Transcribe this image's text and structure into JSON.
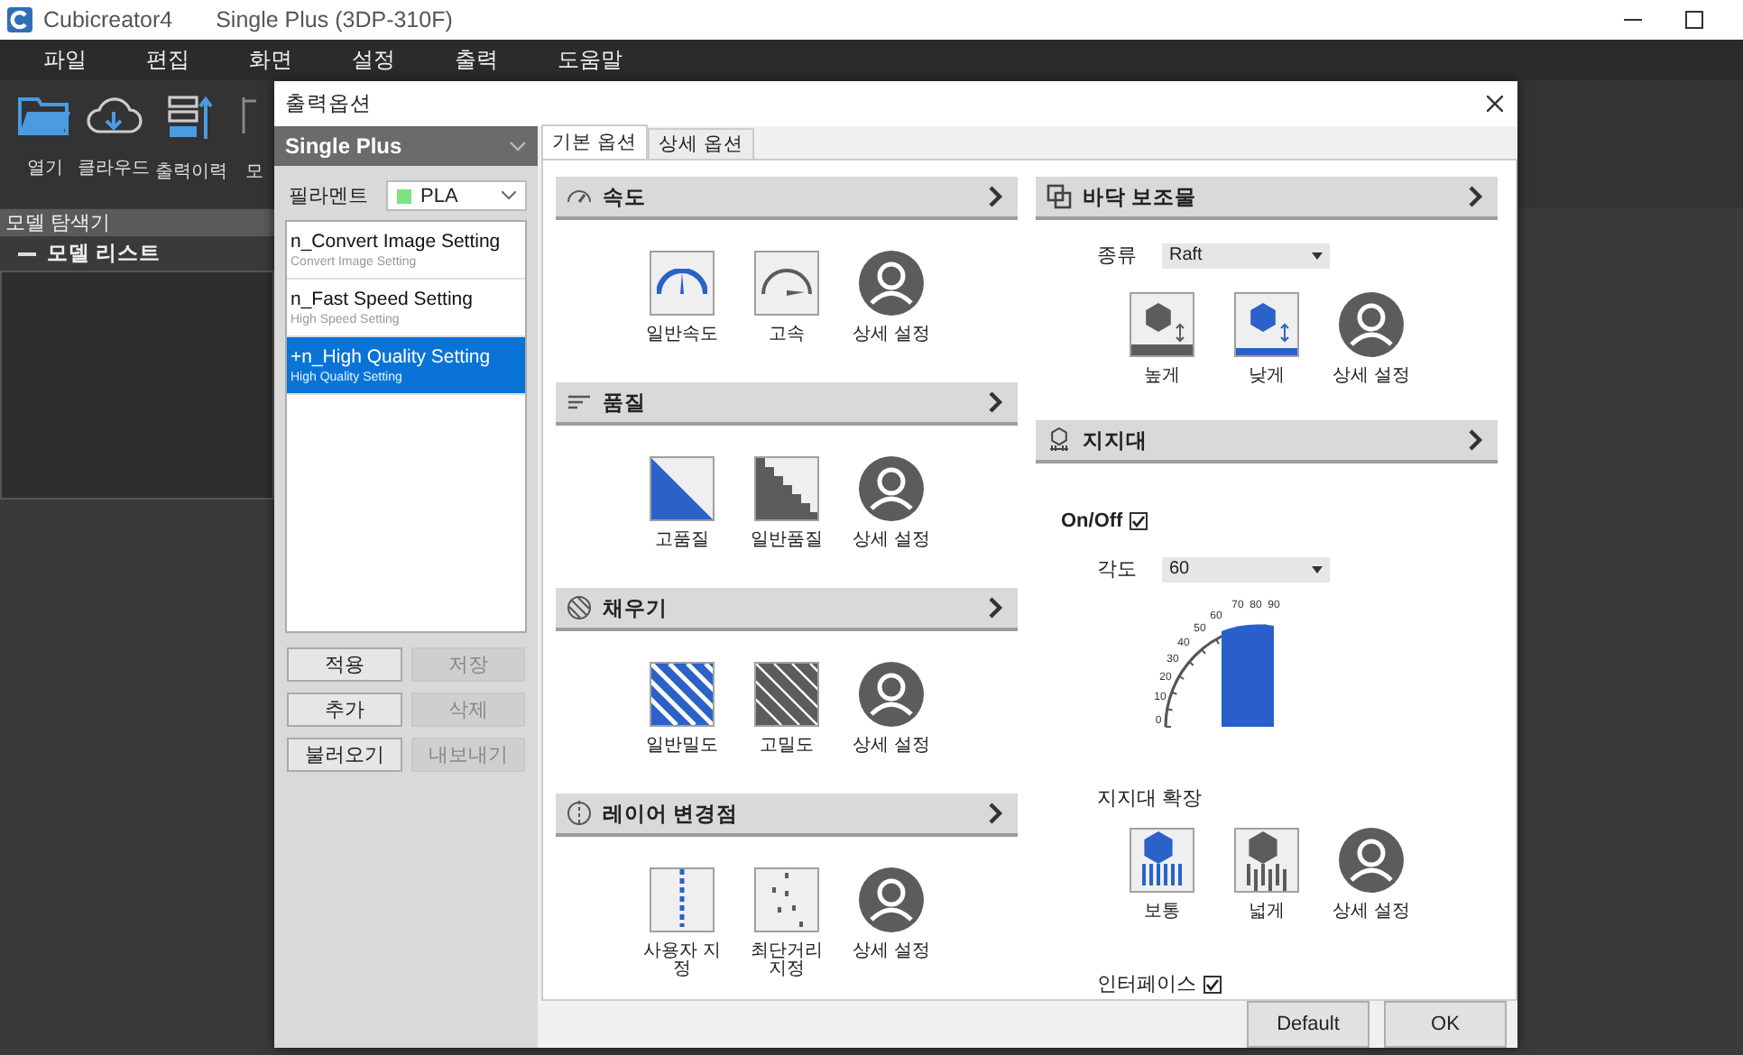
{
  "app": {
    "name": "Cubicreator4",
    "document": "Single Plus (3DP-310F)"
  },
  "menu": [
    "파일",
    "편집",
    "화면",
    "설정",
    "출력",
    "도움말"
  ],
  "toolbar": [
    {
      "label": "열기"
    },
    {
      "label": "클라우드"
    },
    {
      "label": "출력이력"
    },
    {
      "label": "모"
    }
  ],
  "explorer": {
    "title": "모델 탐색기",
    "list_title": "모델 리스트"
  },
  "dialog": {
    "title": "출력옵션",
    "printer": "Single Plus",
    "filament": {
      "label": "필라멘트",
      "value": "PLA"
    },
    "profiles": [
      {
        "name": "n_Convert Image Setting",
        "sub": "Convert Image Setting",
        "selected": false
      },
      {
        "name": "n_Fast Speed Setting",
        "sub": "High Speed Setting",
        "selected": false
      },
      {
        "name": "+n_High Quality Setting",
        "sub": "High Quality Setting",
        "selected": true
      }
    ],
    "buttons": [
      {
        "label": "적용",
        "disabled": false
      },
      {
        "label": "저장",
        "disabled": true
      },
      {
        "label": "추가",
        "disabled": false
      },
      {
        "label": "삭제",
        "disabled": true
      },
      {
        "label": "불러오기",
        "disabled": false
      },
      {
        "label": "내보내기",
        "disabled": true
      }
    ],
    "tabs": [
      {
        "label": "기본 옵션",
        "selected": true
      },
      {
        "label": "상세 옵션",
        "selected": false
      }
    ],
    "left_sections": [
      {
        "title": "속도",
        "options": [
          {
            "kind": "speed-normal",
            "label": "일반속도",
            "selected": true
          },
          {
            "kind": "speed-fast",
            "label": "고속",
            "selected": false
          },
          {
            "kind": "custom",
            "label": "상세 설정",
            "selected": false
          }
        ]
      },
      {
        "title": "품질",
        "options": [
          {
            "kind": "quality-high",
            "label": "고품질",
            "selected": true
          },
          {
            "kind": "quality-normal",
            "label": "일반품질",
            "selected": false
          },
          {
            "kind": "custom",
            "label": "상세 설정",
            "selected": false
          }
        ]
      },
      {
        "title": "채우기",
        "options": [
          {
            "kind": "infill-normal",
            "label": "일반밀도",
            "selected": true
          },
          {
            "kind": "infill-high",
            "label": "고밀도",
            "selected": false
          },
          {
            "kind": "custom",
            "label": "상세 설정",
            "selected": false
          }
        ]
      },
      {
        "title": "레이어 변경점",
        "options": [
          {
            "kind": "layer-custom",
            "label": "사용자 지정",
            "selected": true
          },
          {
            "kind": "layer-shortest",
            "label": "최단거리 지정",
            "selected": false
          },
          {
            "kind": "custom",
            "label": "상세 설정",
            "selected": false
          }
        ]
      }
    ],
    "base": {
      "title": "바닥 보조물",
      "type_label": "종류",
      "type_value": "Raft",
      "options": [
        {
          "kind": "base-high",
          "label": "높게",
          "selected": false
        },
        {
          "kind": "base-low",
          "label": "낮게",
          "selected": true
        },
        {
          "kind": "custom",
          "label": "상세 설정",
          "selected": false
        }
      ]
    },
    "support": {
      "title": "지지대",
      "onoff_label": "On/Off",
      "onoff_checked": true,
      "angle_label": "각도",
      "angle_value": "60",
      "angle_scale": [
        "70",
        "80",
        "90",
        "60",
        "50",
        "40",
        "30",
        "20",
        "10",
        "0"
      ],
      "expansion_label": "지지대 확장",
      "options": [
        {
          "kind": "support-normal",
          "label": "보통",
          "selected": true
        },
        {
          "kind": "support-wide",
          "label": "넓게",
          "selected": false
        },
        {
          "kind": "custom",
          "label": "상세 설정",
          "selected": false
        }
      ],
      "interface_label": "인터페이스",
      "interface_checked": true
    },
    "footer_buttons": [
      "Default",
      "OK"
    ]
  }
}
